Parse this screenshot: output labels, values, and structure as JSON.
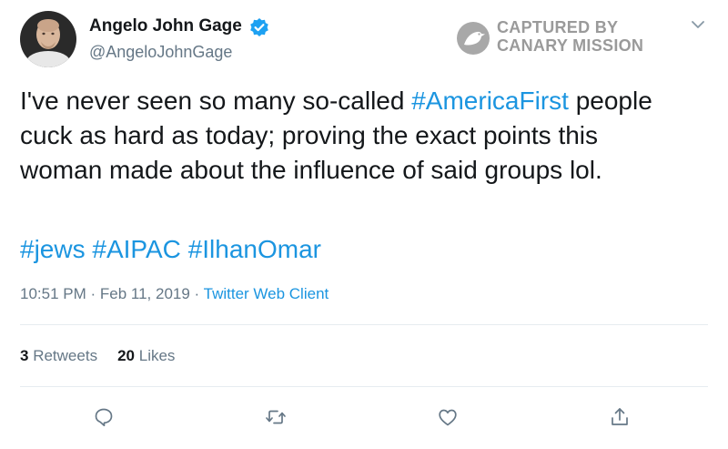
{
  "user": {
    "display_name": "Angelo John Gage",
    "handle": "@AngeloJohnGage",
    "verified": true,
    "avatar_icon": "profile-photo"
  },
  "watermark": {
    "line1": "CAPTURED BY",
    "line2": "CANARY MISSION",
    "icon": "canary-bird-logo"
  },
  "tweet": {
    "line1_before": "I've never seen so many so-called ",
    "line1_hashtag": "#AmericaFirst",
    "line1_after": " people",
    "line2": "cuck as hard as today; proving the exact points this",
    "line3": "woman made about the influence of said groups lol.",
    "hashtags": [
      "#jews",
      "#AIPAC",
      "#IlhanOmar"
    ]
  },
  "meta": {
    "time": "10:51 PM",
    "separator": " · ",
    "date": "Feb 11, 2019",
    "client": "Twitter Web Client"
  },
  "stats": {
    "retweets_count": "3",
    "retweets_label": "Retweets",
    "likes_count": "20",
    "likes_label": "Likes"
  },
  "actions": [
    "reply-icon",
    "retweet-icon",
    "like-icon",
    "share-icon"
  ],
  "colors": {
    "link": "#1b95e0",
    "secondary_text": "#657786",
    "primary_text": "#14171a",
    "verified": "#1da1f2",
    "watermark": "#9a9a9a"
  }
}
